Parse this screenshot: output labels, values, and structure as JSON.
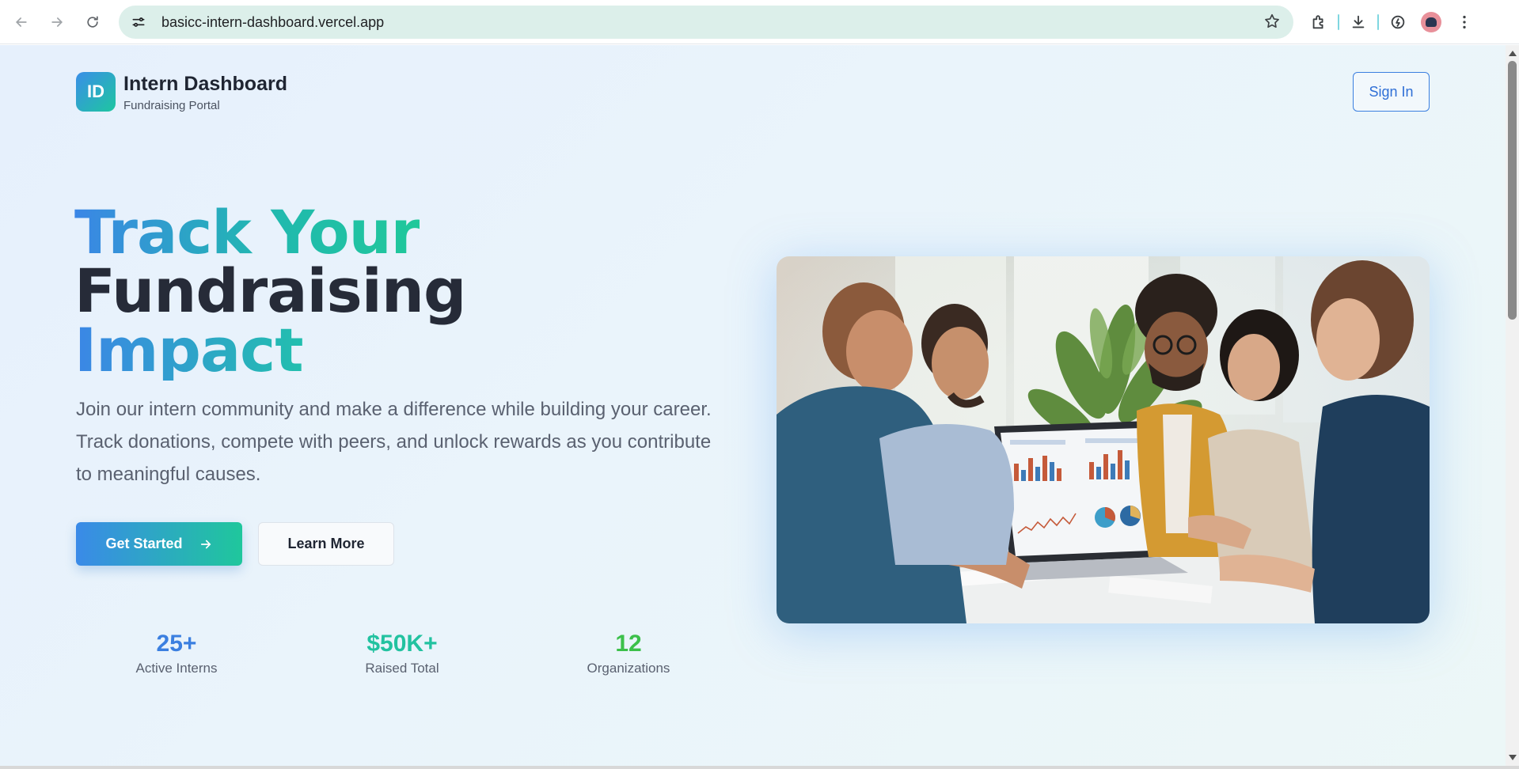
{
  "browser": {
    "url": "basicc-intern-dashboard.vercel.app"
  },
  "header": {
    "logo_text": "ID",
    "title": "Intern Dashboard",
    "subtitle": "Fundraising Portal",
    "sign_in_label": "Sign In"
  },
  "hero": {
    "headline_line1": "Track Your",
    "headline_line2": "Fundraising",
    "headline_line3": "Impact",
    "description": "Join our intern community and make a difference while building your career. Track donations, compete with peers, and unlock rewards as you contribute to meaningful causes.",
    "primary_cta": "Get Started",
    "secondary_cta": "Learn More"
  },
  "stats": [
    {
      "value": "25+",
      "label": "Active Interns",
      "color": "#3b7fe0"
    },
    {
      "value": "$50K+",
      "label": "Raised Total",
      "color": "#22c2a0"
    },
    {
      "value": "12",
      "label": "Organizations",
      "color": "#3cc04a"
    }
  ],
  "colors": {
    "brand_blue": "#3a8ee8",
    "brand_teal": "#1ec6a0",
    "heading_dark": "#262b38"
  }
}
